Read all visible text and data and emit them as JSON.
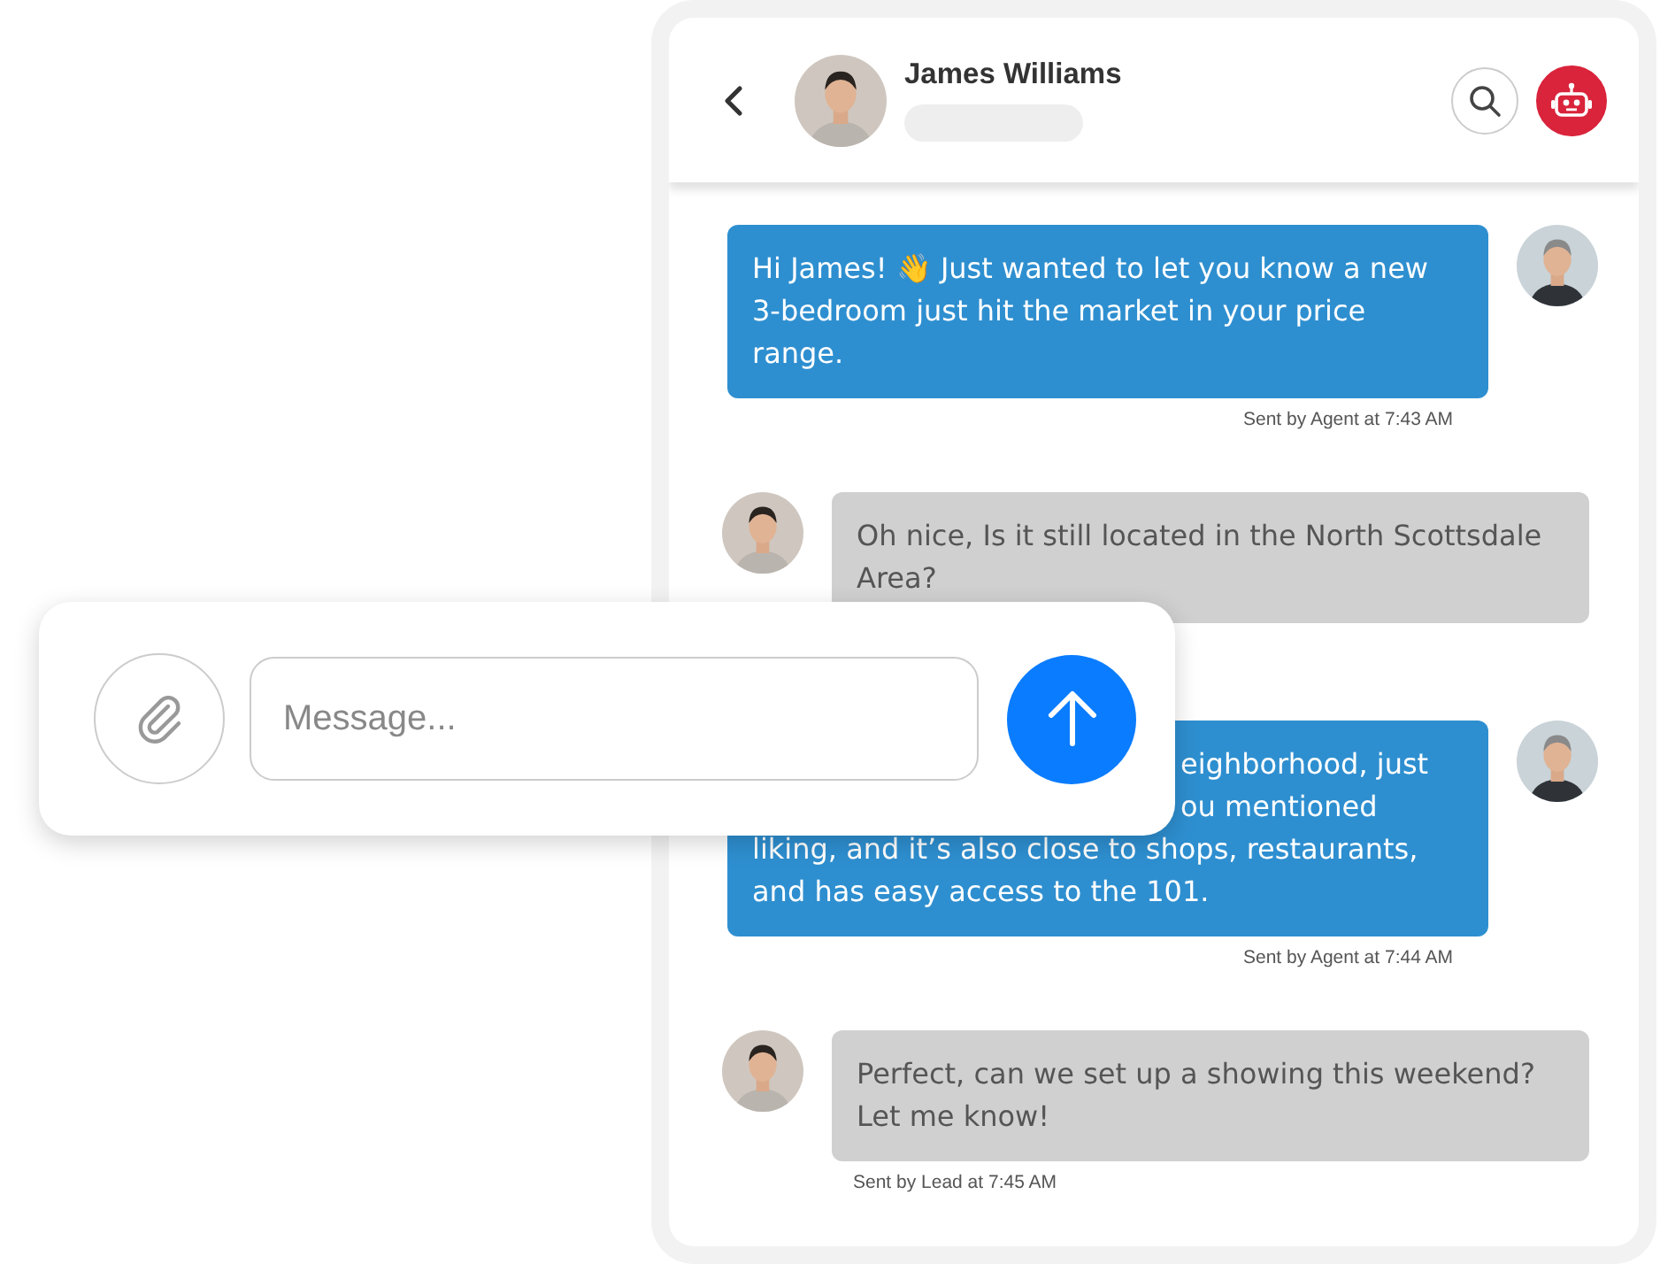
{
  "header": {
    "contact_name": "James Williams",
    "status_loading": true,
    "actions": [
      {
        "kind": "search"
      },
      {
        "kind": "bot"
      }
    ]
  },
  "messages": [
    {
      "kind": "agent",
      "text": "Hi James! 👋 Just wanted to let you know a new 3-bedroom just hit the market in your price range.",
      "meta": "Sent by Agent at 7:43 AM"
    },
    {
      "kind": "lead",
      "text": "Oh nice, Is it still located in the North Scottsdale Area?"
    },
    {
      "kind": "agent",
      "lines": [
        {
          "text": "eighborhood, just",
          "covered": true
        },
        {
          "text": "ou mentioned",
          "covered": true
        },
        {
          "text": "liking, and it’s also close to shops, restaurants,",
          "covered": false
        },
        {
          "text": "and has easy access to the 101.",
          "covered": false
        }
      ],
      "meta": "Sent by Agent at 7:44 AM"
    },
    {
      "kind": "lead",
      "text": "Perfect, can we set up a showing this weekend? Let me know!",
      "meta": "Sent by Lead at 7:45 AM"
    }
  ],
  "composer": {
    "placeholder": "Message..."
  }
}
